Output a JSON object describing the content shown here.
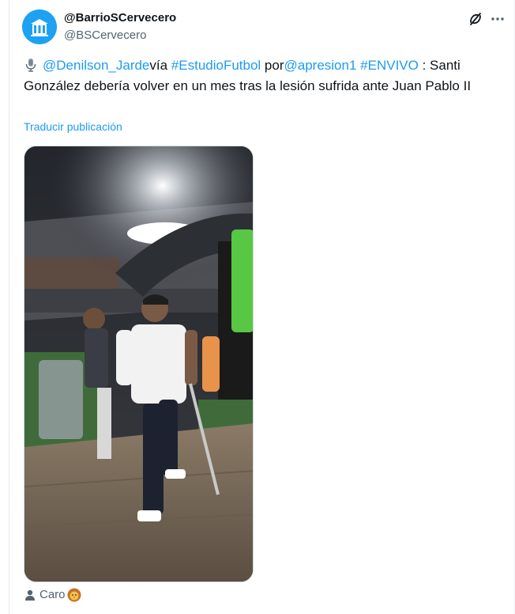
{
  "author": {
    "display_name": "@BarrioSCervecero",
    "handle": "@BSCervecero",
    "avatar_icon": "barrio-avatar-icon"
  },
  "header_actions": {
    "grok_icon": "grok-icon",
    "more_icon": "more-icon"
  },
  "tweet": {
    "mic_icon": "microphone-icon",
    "parts": {
      "mention1": "@Denilson_Jarde",
      "text1": "vía ",
      "hashtag1": "#EstudioFutbol",
      "text2": " por",
      "mention2": "@apresion1",
      "text3": " ",
      "hashtag2": "#ENVIVO",
      "text4": " : Santi González debería volver en un mes tras la lesión sufrida ante Juan Pablo II"
    },
    "translate_label": "Traducir publicación"
  },
  "media": {
    "type": "video-still",
    "description_icon": "media-image"
  },
  "tagged": {
    "person_icon": "person-icon",
    "name": "Caro",
    "emoji_icon": "lion-face-icon"
  },
  "colors": {
    "link": "#1d9bf0",
    "text": "#0f1419",
    "secondary": "#536471",
    "border": "#cfd9de"
  }
}
